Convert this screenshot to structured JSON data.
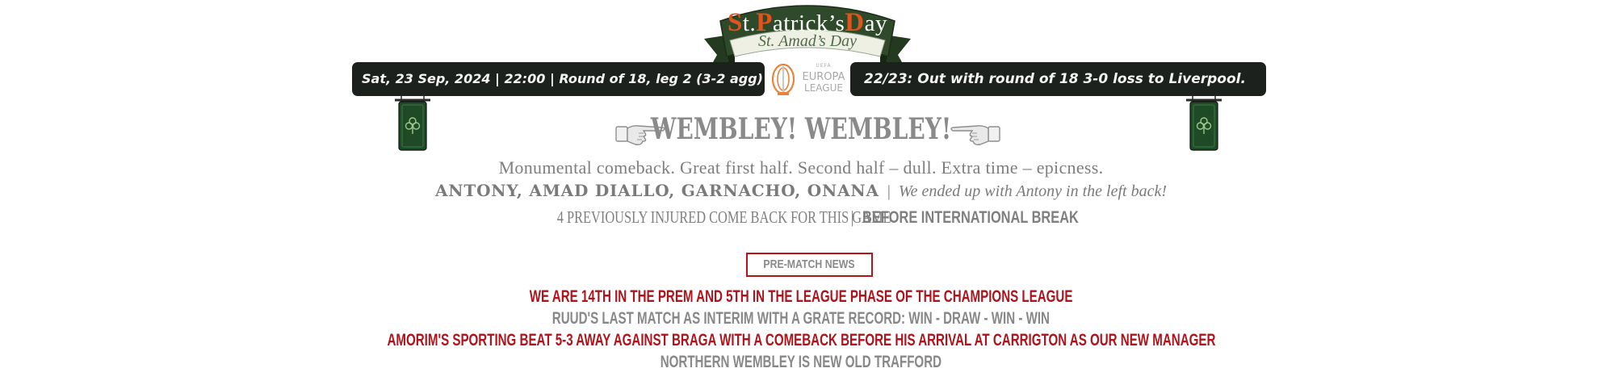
{
  "banner": {
    "title_cap1": "S",
    "title_mid1": "t.",
    "title_cap2": "P",
    "title_mid2": "atrick’s",
    "title_cap3": "D",
    "title_mid3": "ay",
    "subtitle": "St. Amad’s Day"
  },
  "match": {
    "info": "Sat, 23 Sep, 2024 | 22:00 | Round of 18, leg 2 (3-2 agg)",
    "history": "22/23: Out with round of 18 3-0 loss to Liverpool.",
    "competition_logo": {
      "uefa": "UEFA",
      "word1": "EUROPA",
      "word2": "LEAGUE",
      "icon": "trophy-icon"
    }
  },
  "headline": "WEMBLEY! WEMBLEY!",
  "tagline": "Monumental comeback. Great first half. Second half – dull. Extra time – epicness.",
  "players": "ANTONY, AMAD DIALLO, GARNACHO, ONANA",
  "separator": "|",
  "left_back_note": "We ended up with Antony in the left back!",
  "injured_note": "4 PREVIOUSLY INJURED COME BACK FOR THIS GAME",
  "break_note": "BEFORE INTERNATIONAL BREAK",
  "news": {
    "label": "PRE-MATCH NEWS",
    "items": [
      "WE ARE 14TH IN THE PREM AND 5TH IN THE LEAGUE PHASE OF THE CHAMPIONS LEAGUE",
      "RUUD'S LAST MATCH AS INTERIM WITH A GRATE RECORD: WIN - DRAW - WIN - WIN",
      "AMORIM'S SPORTING BEAT 5-3 AWAY AGAINST BRAGA WITH A COMEBACK BEFORE HIS ARRIVAL AT CARRIGTON AS OUR NEW MANAGER",
      "NORTHERN WEMBLEY IS NEW OLD TRAFFORD"
    ]
  },
  "colors": {
    "banner_green": "#2f4a2a",
    "accent_red": "#ad141c",
    "pill_bg": "#1d211d",
    "text_gray": "#888888"
  },
  "icons": [
    "shamrock-icon",
    "pointing-hand-icon",
    "trophy-icon"
  ]
}
